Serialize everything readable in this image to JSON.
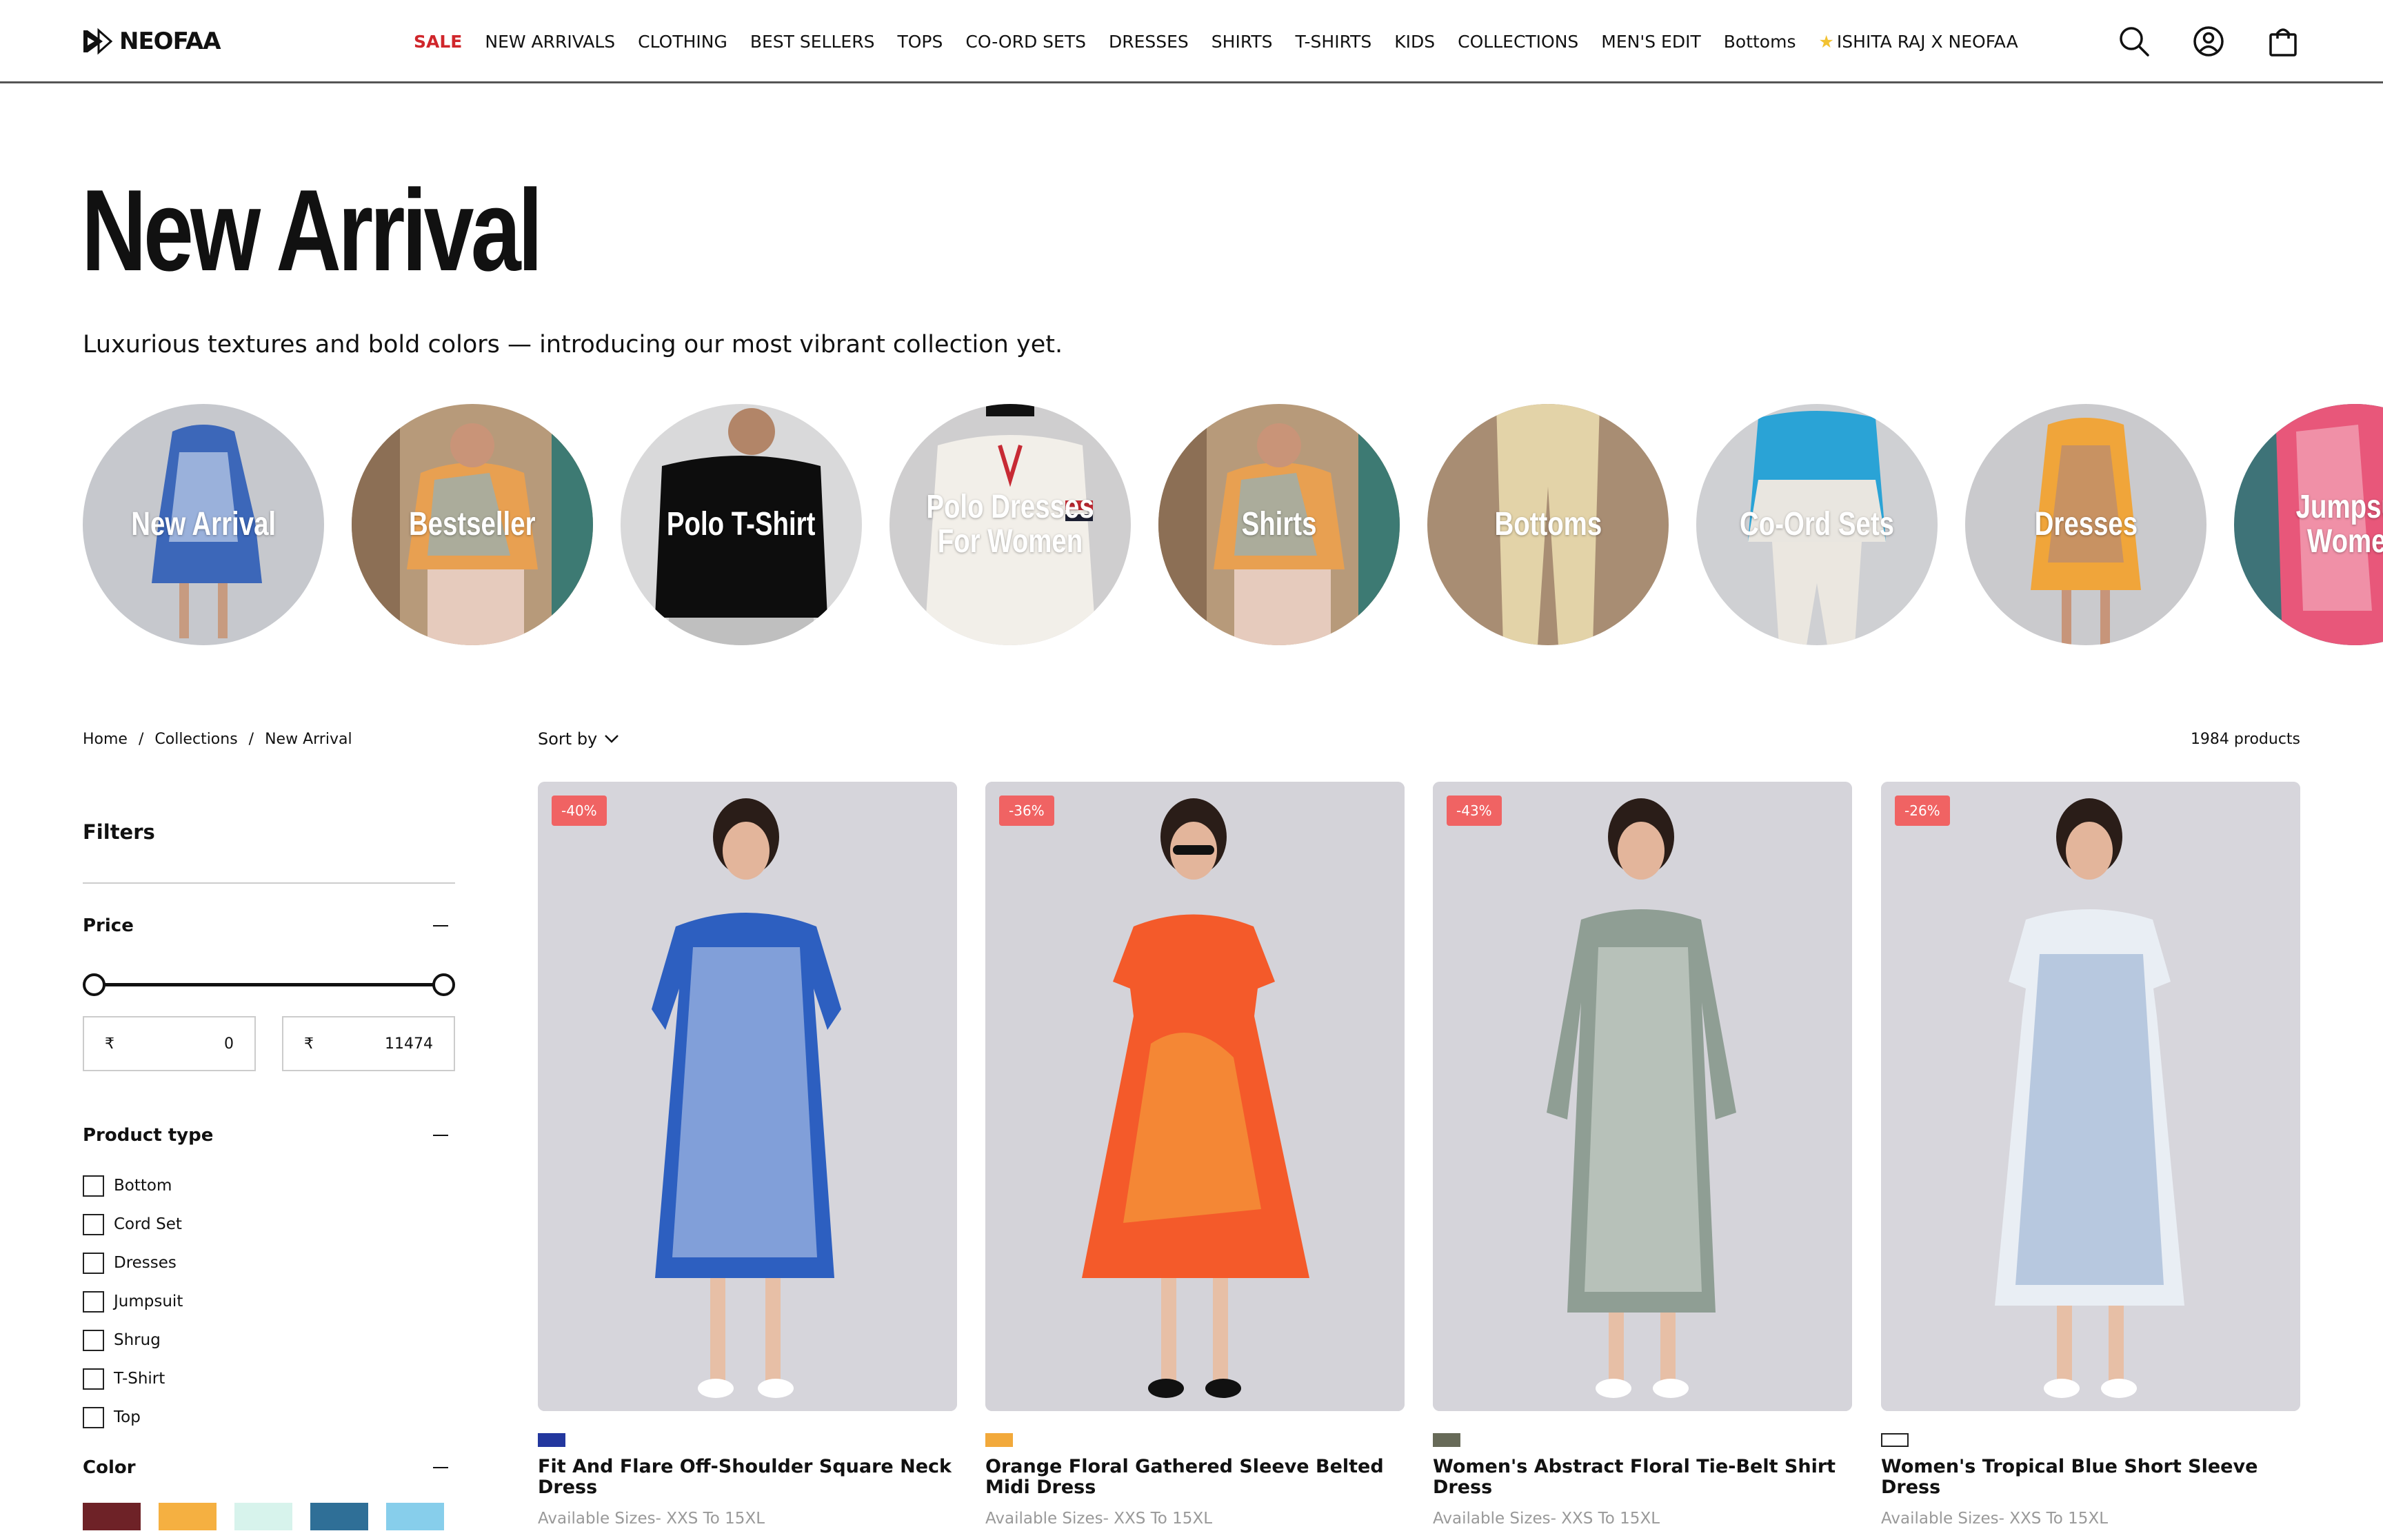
{
  "header": {
    "logo_text": "NEOFAA",
    "nav": [
      "SALE",
      "NEW ARRIVALS",
      "CLOTHING",
      "BEST SELLERS",
      "TOPS",
      "CO-ORD SETS",
      "DRESSES",
      "SHIRTS",
      "T-SHIRTS",
      "KIDS",
      "COLLECTIONS",
      "MEN'S EDIT",
      "Bottoms",
      "ISHITA RAJ X NEOFAA"
    ],
    "icons": [
      "search-icon",
      "account-icon",
      "bag-icon"
    ],
    "sale_color": "#d0262b"
  },
  "hero": {
    "title": "New Arrival",
    "subtitle": "Luxurious textures and bold colors — introducing our most vibrant collection yet."
  },
  "categories": [
    {
      "label": "New Arrival"
    },
    {
      "label": "Bestseller"
    },
    {
      "label": "Polo T-Shirt"
    },
    {
      "label": "Polo Dresses For Women"
    },
    {
      "label": "Shirts"
    },
    {
      "label": "Bottoms"
    },
    {
      "label": "Co-Ord Sets"
    },
    {
      "label": "Dresses"
    },
    {
      "label": "Jumpsuit Women"
    }
  ],
  "breadcrumb": [
    "Home",
    "Collections",
    "New Arrival"
  ],
  "toolbar": {
    "sort_label": "Sort by",
    "count": "1984 products"
  },
  "filters": {
    "title": "Filters",
    "price": {
      "label": "Price",
      "currency": "₹",
      "min": "0",
      "max": "11474"
    },
    "product_type": {
      "label": "Product type",
      "options": [
        "Bottom",
        "Cord Set",
        "Dresses",
        "Jumpsuit",
        "Shrug",
        "T-Shirt",
        "Top"
      ]
    },
    "color": {
      "label": "Color",
      "swatches": [
        "#6e2227",
        "#f5b041",
        "#d7f3ec",
        "#2f6f97",
        "#87ceeb",
        "#dcd8c0",
        "#0a0a0a",
        "#f8d7d1",
        "#ef8f7f",
        "#ee6fc4"
      ]
    }
  },
  "products": [
    {
      "discount": "-40%",
      "title": "Fit And Flare Off-Shoulder Square Neck Dress",
      "sizes": "Available Sizes- XXS To 15XL",
      "color": "#23379e"
    },
    {
      "discount": "-36%",
      "title": "Orange Floral Gathered Sleeve Belted Midi Dress",
      "sizes": "Available Sizes- XXS To 15XL",
      "color": "#f2a93b"
    },
    {
      "discount": "-43%",
      "title": "Women's Abstract Floral Tie-Belt Shirt Dress",
      "sizes": "Available Sizes- XXS To 15XL",
      "color": "#676a58"
    },
    {
      "discount": "-26%",
      "title": "Women's Tropical Blue Short Sleeve Dress",
      "sizes": "Available Sizes- XXS To 15XL",
      "color": "#ffffff"
    }
  ]
}
